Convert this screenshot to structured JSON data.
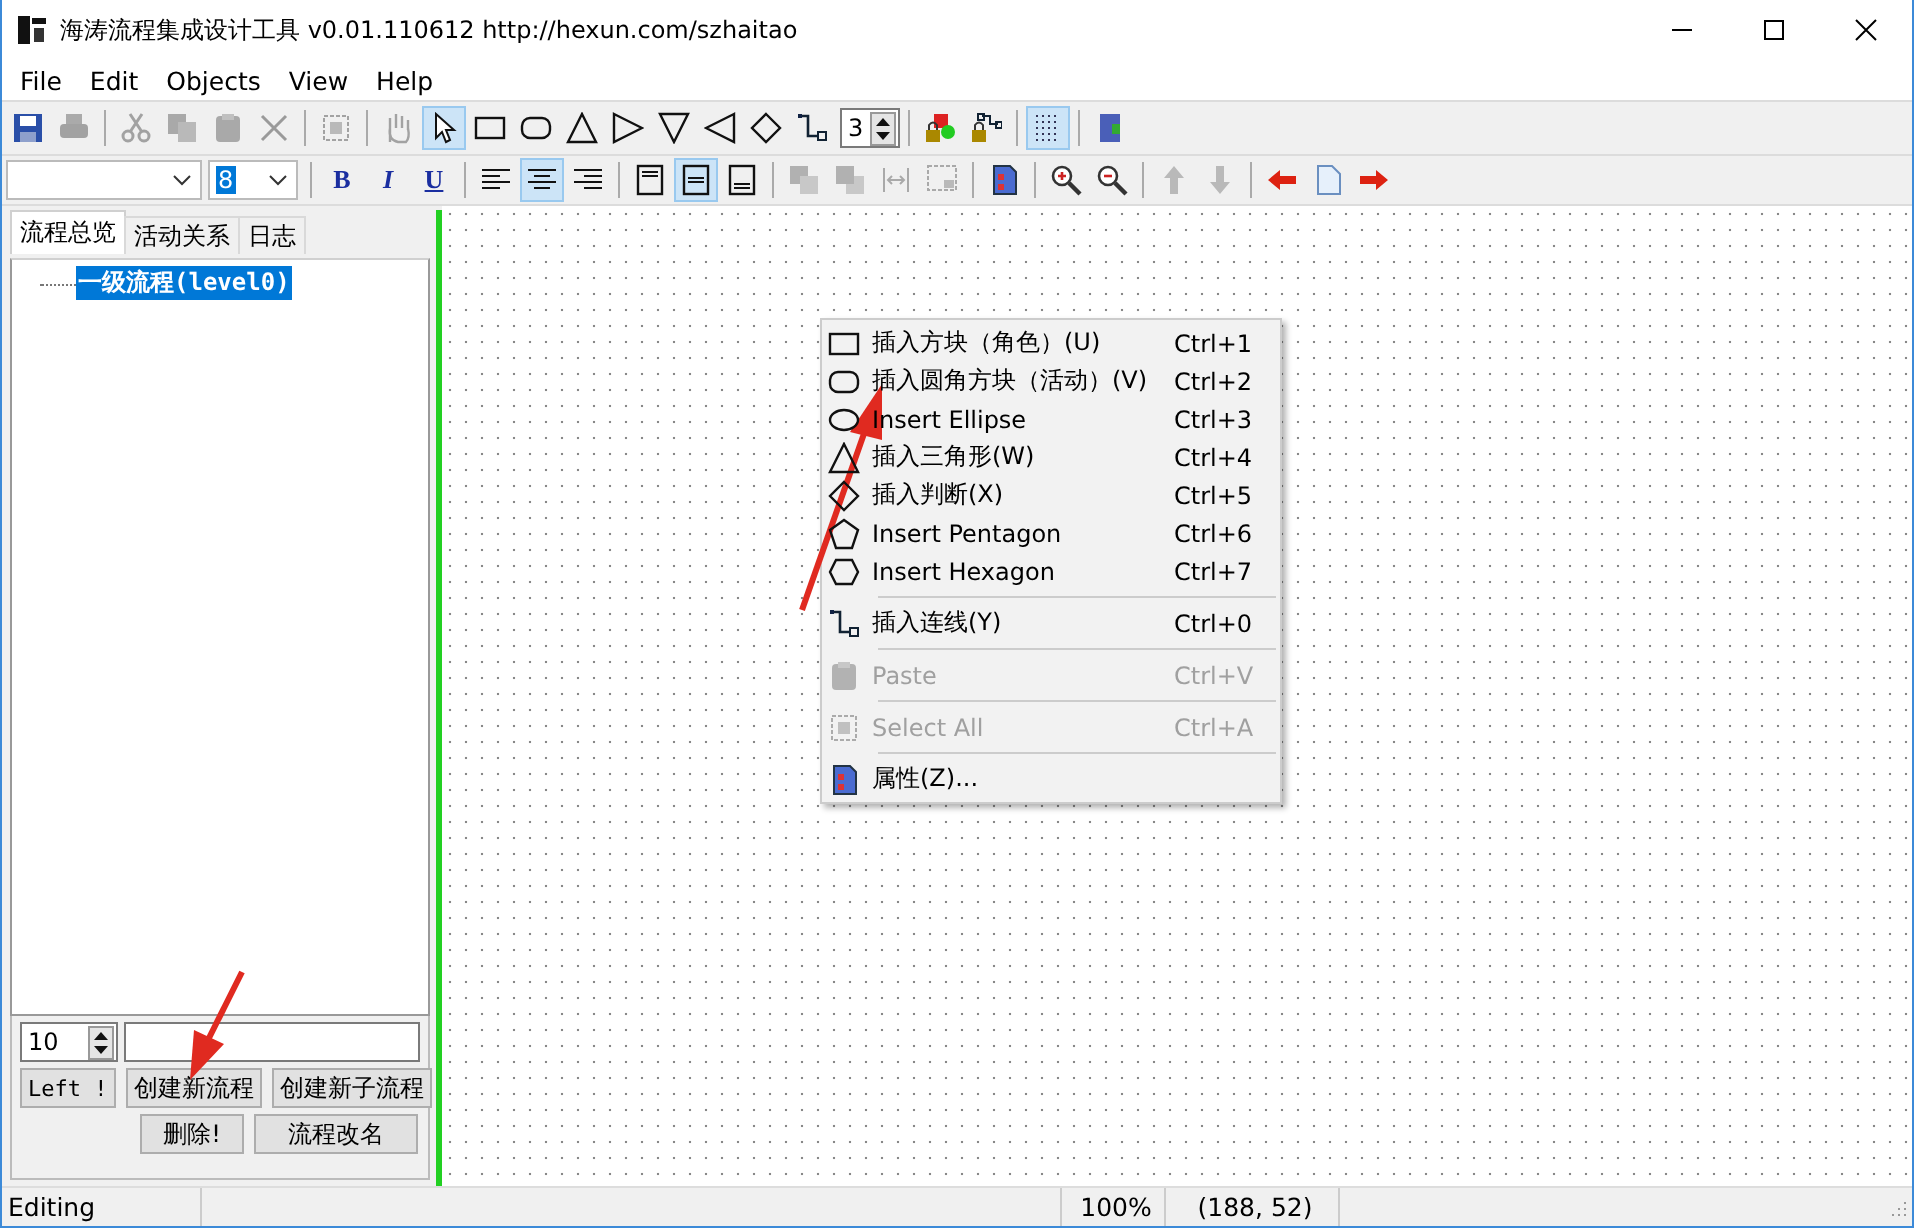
{
  "window": {
    "title": "海涛流程集成设计工具 v0.01.110612 http://hexun.com/szhaitao"
  },
  "menu": [
    "File",
    "Edit",
    "Objects",
    "View",
    "Help"
  ],
  "toolbar": [
    {
      "kind": "save",
      "disabled": false,
      "selected": false
    },
    {
      "kind": "print",
      "disabled": true,
      "selected": false
    },
    {
      "kind": "separator"
    },
    {
      "kind": "cut",
      "disabled": true,
      "selected": false
    },
    {
      "kind": "copy",
      "disabled": true,
      "selected": false
    },
    {
      "kind": "paste",
      "disabled": true,
      "selected": false
    },
    {
      "kind": "delete",
      "disabled": true,
      "selected": false
    },
    {
      "kind": "separator"
    },
    {
      "kind": "select-all",
      "disabled": true,
      "selected": false
    },
    {
      "kind": "separator"
    },
    {
      "kind": "hand",
      "disabled": true,
      "selected": false
    },
    {
      "kind": "pointer",
      "disabled": false,
      "selected": true
    },
    {
      "kind": "rect",
      "disabled": false,
      "selected": false
    },
    {
      "kind": "roundrect",
      "disabled": false,
      "selected": false
    },
    {
      "kind": "tri-up",
      "disabled": false,
      "selected": false
    },
    {
      "kind": "tri-right",
      "disabled": false,
      "selected": false
    },
    {
      "kind": "tri-down",
      "disabled": false,
      "selected": false
    },
    {
      "kind": "tri-left",
      "disabled": false,
      "selected": false
    },
    {
      "kind": "diamond",
      "disabled": false,
      "selected": false
    },
    {
      "kind": "connector",
      "disabled": false,
      "selected": false
    },
    {
      "kind": "spin",
      "value": "3"
    },
    {
      "kind": "separator"
    },
    {
      "kind": "lock-shape",
      "disabled": false,
      "selected": false
    },
    {
      "kind": "lock-connector",
      "disabled": false,
      "selected": false
    },
    {
      "kind": "separator"
    },
    {
      "kind": "grid",
      "disabled": false,
      "selected": true
    },
    {
      "kind": "separator"
    },
    {
      "kind": "exit",
      "disabled": false,
      "selected": false
    }
  ],
  "format_bar": [
    {
      "kind": "font-combo"
    },
    {
      "kind": "size-combo",
      "value": "8",
      "text_selected": true
    },
    {
      "kind": "separator"
    },
    {
      "kind": "bold",
      "label": "B"
    },
    {
      "kind": "italic",
      "label": "I"
    },
    {
      "kind": "underline",
      "label": "U"
    },
    {
      "kind": "separator"
    },
    {
      "kind": "align-left",
      "disabled": false,
      "selected": false
    },
    {
      "kind": "align-center",
      "disabled": false,
      "selected": true
    },
    {
      "kind": "align-right",
      "disabled": false,
      "selected": false
    },
    {
      "kind": "separator"
    },
    {
      "kind": "valign-top",
      "disabled": false,
      "selected": false
    },
    {
      "kind": "valign-middle",
      "disabled": false,
      "selected": true
    },
    {
      "kind": "valign-bottom",
      "disabled": false,
      "selected": false
    },
    {
      "kind": "separator"
    },
    {
      "kind": "front",
      "disabled": true,
      "selected": false
    },
    {
      "kind": "back",
      "disabled": true,
      "selected": false
    },
    {
      "kind": "space",
      "disabled": true,
      "selected": false
    },
    {
      "kind": "fit",
      "disabled": true,
      "selected": false
    },
    {
      "kind": "separator"
    },
    {
      "kind": "properties",
      "disabled": false,
      "selected": false
    },
    {
      "kind": "separator"
    },
    {
      "kind": "zoom-in",
      "disabled": false,
      "selected": false
    },
    {
      "kind": "zoom-out",
      "disabled": false,
      "selected": false
    },
    {
      "kind": "separator"
    },
    {
      "kind": "up",
      "disabled": true,
      "selected": false
    },
    {
      "kind": "down",
      "disabled": true,
      "selected": false
    },
    {
      "kind": "separator"
    },
    {
      "kind": "prev",
      "disabled": false,
      "selected": false
    },
    {
      "kind": "page",
      "disabled": false,
      "selected": false
    },
    {
      "kind": "next",
      "disabled": false,
      "selected": false
    }
  ],
  "tabs": [
    {
      "label": "流程总览",
      "selected": true
    },
    {
      "label": "活动关系",
      "selected": false
    },
    {
      "label": "日志",
      "selected": false
    }
  ],
  "tree": [
    {
      "label": "一级流程(level0)",
      "selected": true
    }
  ],
  "spin_value": "10",
  "buttons": [
    "Left !",
    "创建新流程",
    "创建新子流程",
    "删除!",
    "流程改名"
  ],
  "context_menu": [
    {
      "kind": "rect",
      "label": "插入方块（角色）(U)",
      "shortcut": "Ctrl+1",
      "disabled": false
    },
    {
      "kind": "roundrect",
      "label": "插入圆角方块（活动）(V)",
      "shortcut": "Ctrl+2",
      "disabled": false
    },
    {
      "kind": "ellipse",
      "label": "Insert Ellipse",
      "shortcut": "Ctrl+3",
      "disabled": false
    },
    {
      "kind": "tri-up",
      "label": "插入三角形(W)",
      "shortcut": "Ctrl+4",
      "disabled": false
    },
    {
      "kind": "diamond",
      "label": "插入判断(X)",
      "shortcut": "Ctrl+5",
      "disabled": false
    },
    {
      "kind": "pentagon",
      "label": "Insert Pentagon",
      "shortcut": "Ctrl+6",
      "disabled": false
    },
    {
      "kind": "hexagon",
      "label": "Insert Hexagon",
      "shortcut": "Ctrl+7",
      "disabled": false
    },
    {
      "kind": "separator"
    },
    {
      "kind": "connector",
      "label": "插入连线(Y)",
      "shortcut": "Ctrl+0",
      "disabled": false
    },
    {
      "kind": "separator"
    },
    {
      "kind": "paste",
      "label": "Paste",
      "shortcut": "Ctrl+V",
      "disabled": true
    },
    {
      "kind": "separator"
    },
    {
      "kind": "select-all",
      "label": "Select All",
      "shortcut": "Ctrl+A",
      "disabled": true
    },
    {
      "kind": "separator"
    },
    {
      "kind": "properties",
      "label": "属性(Z)...",
      "disabled": false
    }
  ],
  "status_bar": [
    "Editing",
    "100%",
    "(188, 52)"
  ]
}
